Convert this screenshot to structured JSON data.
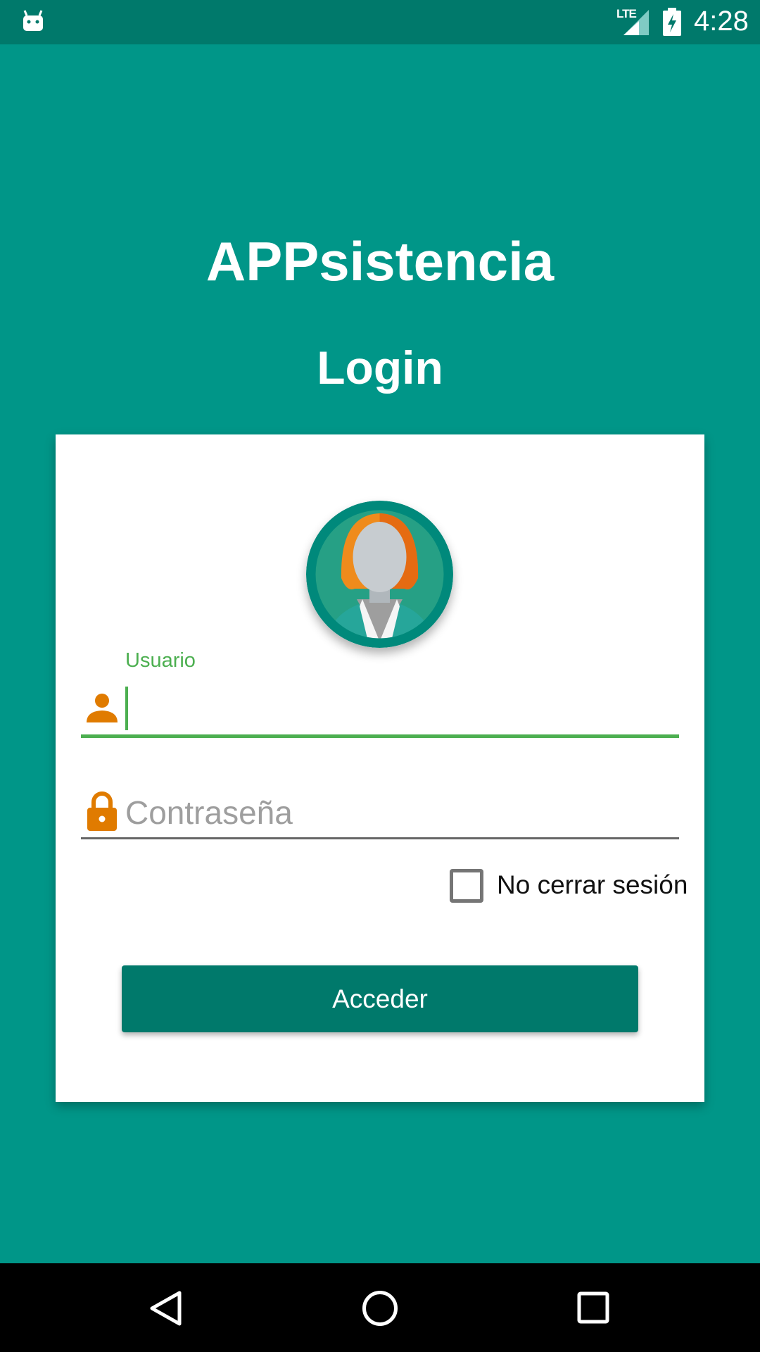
{
  "status_bar": {
    "time": "4:28",
    "network": "LTE",
    "icons": [
      "android-debug-icon",
      "signal-icon",
      "battery-charging-icon"
    ]
  },
  "app": {
    "title": "APPsistencia",
    "subtitle": "Login"
  },
  "form": {
    "avatar_icon": "user-avatar-icon",
    "username": {
      "label": "Usuario",
      "value": "",
      "icon": "person-icon",
      "focused": true
    },
    "password": {
      "placeholder": "Contraseña",
      "value": "",
      "icon": "lock-icon"
    },
    "keep_session": {
      "label": "No cerrar sesión",
      "checked": false
    },
    "submit_label": "Acceder"
  },
  "nav_bar": {
    "icons": [
      "back-icon",
      "home-icon",
      "recents-icon"
    ]
  },
  "colors": {
    "background": "#009688",
    "status_bar": "#00796b",
    "button": "#00796b",
    "focus_accent": "#4caf50",
    "icon_accent": "#e07b00",
    "card": "#ffffff"
  }
}
